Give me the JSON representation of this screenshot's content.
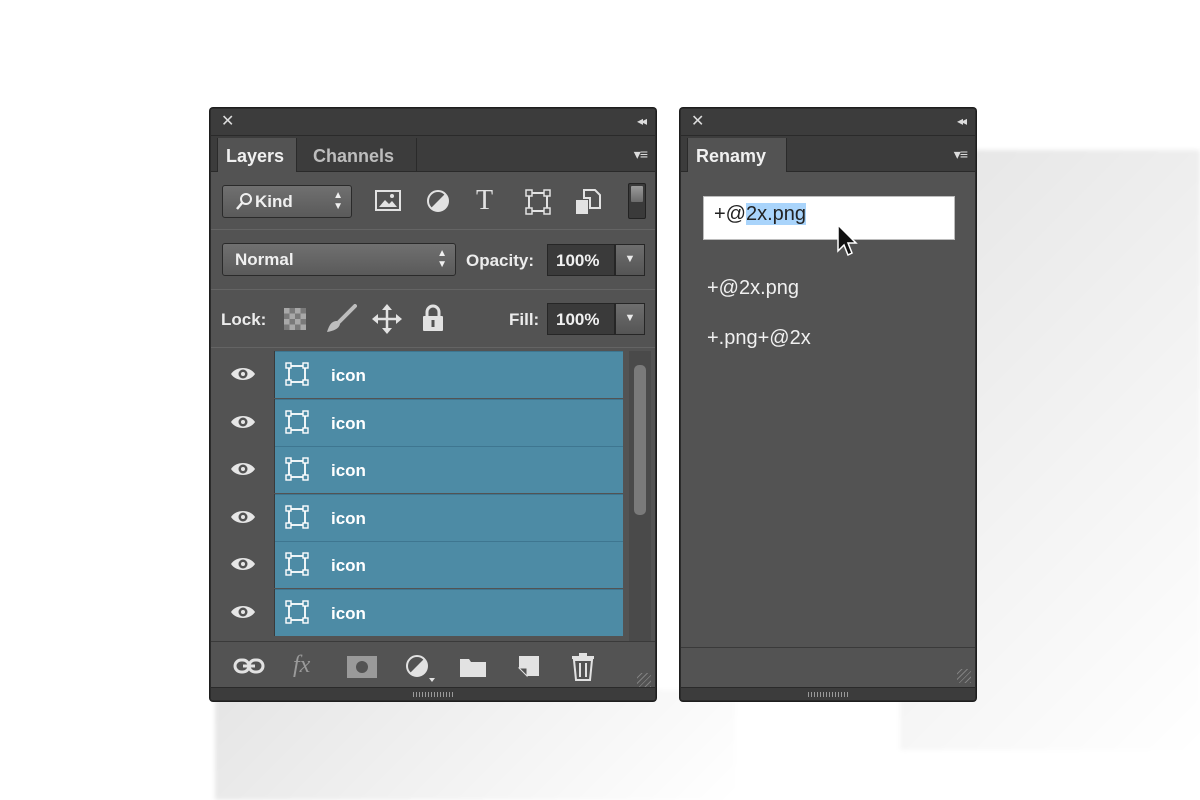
{
  "layers_panel": {
    "close_glyph": "✕",
    "collapse_glyph": "◂◂",
    "tabs": [
      {
        "label": "Layers",
        "active": true
      },
      {
        "label": "Channels",
        "active": false
      }
    ],
    "menu_glyph": "▾≡",
    "filter": {
      "label": "Kind",
      "icon": "search-icon"
    },
    "filter_icons": [
      "image-filter-icon",
      "adjustment-filter-icon",
      "type-filter-icon",
      "shape-filter-icon",
      "smart-object-filter-icon"
    ],
    "type_glyph": "T",
    "blend_mode": "Normal",
    "opacity_label": "Opacity:",
    "opacity_value": "100%",
    "lock_label": "Lock:",
    "lock_icons": [
      "lock-transparent-icon",
      "lock-image-icon",
      "lock-position-icon",
      "lock-all-icon"
    ],
    "fill_label": "Fill:",
    "fill_value": "100%",
    "layers": [
      {
        "name": "icon",
        "visible": true,
        "selected": true
      },
      {
        "name": "icon",
        "visible": true,
        "selected": true
      },
      {
        "name": "icon",
        "visible": true,
        "selected": true
      },
      {
        "name": "icon",
        "visible": true,
        "selected": true
      },
      {
        "name": "icon",
        "visible": true,
        "selected": true
      },
      {
        "name": "icon",
        "visible": true,
        "selected": true
      }
    ],
    "bottom_icons": [
      "link-icon",
      "fx-icon",
      "mask-icon",
      "adjustment-icon",
      "folder-icon",
      "new-layer-icon",
      "trash-icon"
    ],
    "fx_glyph": "fx"
  },
  "renamy_panel": {
    "close_glyph": "✕",
    "collapse_glyph": "◂◂",
    "tab_label": "Renamy",
    "menu_glyph": "▾≡",
    "input_prefix": "+@",
    "input_selected": "2x.png",
    "history": [
      "+@2x.png",
      "+.png+@2x"
    ]
  },
  "colors": {
    "panel_bg": "#535353",
    "header_bg": "#3c3c3c",
    "layer_selected": "#4d8ba5",
    "selection_highlight": "#a9d4fb"
  }
}
